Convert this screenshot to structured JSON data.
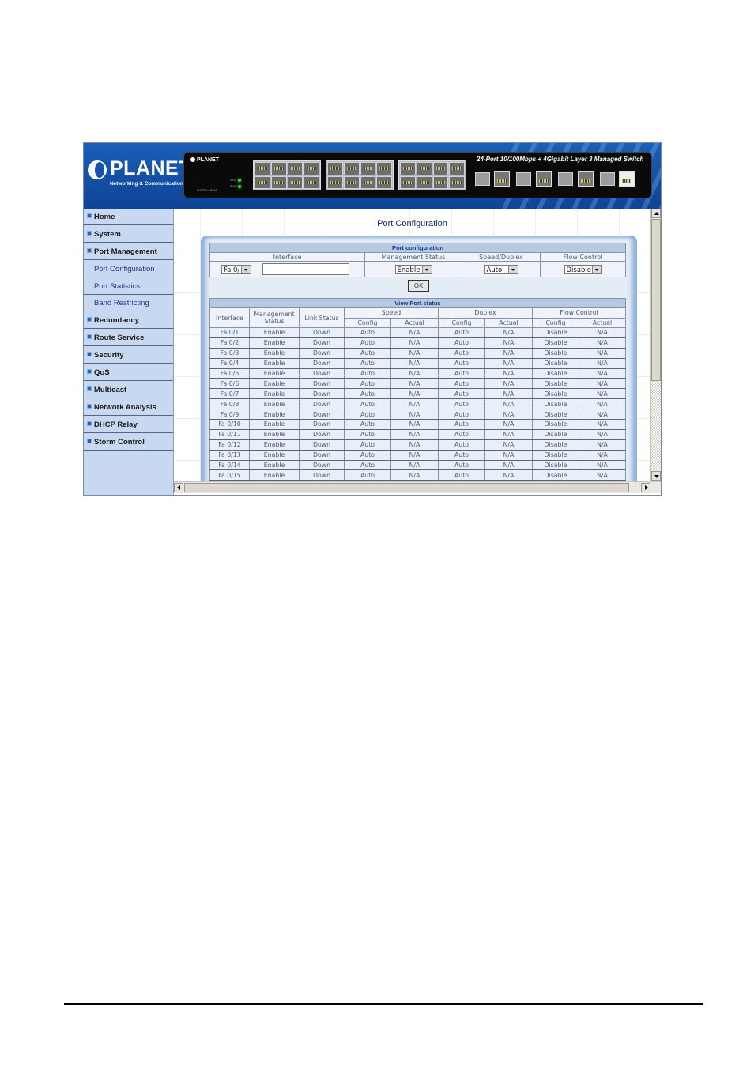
{
  "banner": {
    "brand": "PLANET",
    "tagline": "Networking & Communication",
    "device_logo": "PLANET",
    "device_model": "WGSW-L2648",
    "device_title": "24-Port 10/100Mbps + 4Gigabit Layer 3 Managed Switch",
    "led_labels": [
      "SYS",
      "PWR"
    ],
    "top_port_numbers": [
      "2",
      "4",
      "6",
      "8",
      "10",
      "12",
      "14",
      "16",
      "18",
      "20",
      "22",
      "24"
    ],
    "bottom_port_numbers": [
      "1",
      "3",
      "5",
      "7",
      "9",
      "11",
      "13",
      "15",
      "17",
      "19",
      "21",
      "23"
    ],
    "gigabit_labels": [
      "25",
      "26",
      "27",
      "28"
    ],
    "sfp_label": "mini-GBIC"
  },
  "sidebar": {
    "items": [
      {
        "label": "Home",
        "type": "main"
      },
      {
        "label": "System",
        "type": "main"
      },
      {
        "label": "Port Management",
        "type": "main"
      },
      {
        "label": "Port Configuration",
        "type": "sub"
      },
      {
        "label": "Port Statistics",
        "type": "sub"
      },
      {
        "label": "Band Restricting",
        "type": "sub"
      },
      {
        "label": "Redundancy",
        "type": "main"
      },
      {
        "label": "Route Service",
        "type": "main"
      },
      {
        "label": "Security",
        "type": "main"
      },
      {
        "label": "QoS",
        "type": "main"
      },
      {
        "label": "Multicast",
        "type": "main"
      },
      {
        "label": "Network Analysis",
        "type": "main"
      },
      {
        "label": "DHCP Relay",
        "type": "main"
      },
      {
        "label": "Storm Control",
        "type": "main"
      }
    ]
  },
  "page": {
    "title": "Port Configuration"
  },
  "config": {
    "section_title": "Port configuration",
    "headers": [
      "Interface",
      "Management Status",
      "Speed/Duplex",
      "Flow Control"
    ],
    "interface_select": "Fa 0/",
    "interface_input": "",
    "management_select": "Enable",
    "speed_select": "Auto",
    "flow_select": "Disable",
    "ok_label": "OK"
  },
  "status": {
    "section_title": "View Port status",
    "headers": {
      "interface": "Interface",
      "management": "Management Status",
      "link": "Link Status",
      "speed": "Speed",
      "duplex": "Duplex",
      "flow": "Flow Control",
      "config": "Config",
      "actual": "Actual"
    },
    "rows": [
      [
        "Fa 0/1",
        "Enable",
        "Down",
        "Auto",
        "N/A",
        "Auto",
        "N/A",
        "Disable",
        "N/A"
      ],
      [
        "Fa 0/2",
        "Enable",
        "Down",
        "Auto",
        "N/A",
        "Auto",
        "N/A",
        "Disable",
        "N/A"
      ],
      [
        "Fa 0/3",
        "Enable",
        "Down",
        "Auto",
        "N/A",
        "Auto",
        "N/A",
        "Disable",
        "N/A"
      ],
      [
        "Fa 0/4",
        "Enable",
        "Down",
        "Auto",
        "N/A",
        "Auto",
        "N/A",
        "Disable",
        "N/A"
      ],
      [
        "Fa 0/5",
        "Enable",
        "Down",
        "Auto",
        "N/A",
        "Auto",
        "N/A",
        "Disable",
        "N/A"
      ],
      [
        "Fa 0/6",
        "Enable",
        "Down",
        "Auto",
        "N/A",
        "Auto",
        "N/A",
        "Disable",
        "N/A"
      ],
      [
        "Fa 0/7",
        "Enable",
        "Down",
        "Auto",
        "N/A",
        "Auto",
        "N/A",
        "Disable",
        "N/A"
      ],
      [
        "Fa 0/8",
        "Enable",
        "Down",
        "Auto",
        "N/A",
        "Auto",
        "N/A",
        "Disable",
        "N/A"
      ],
      [
        "Fa 0/9",
        "Enable",
        "Down",
        "Auto",
        "N/A",
        "Auto",
        "N/A",
        "Disable",
        "N/A"
      ],
      [
        "Fa 0/10",
        "Enable",
        "Down",
        "Auto",
        "N/A",
        "Auto",
        "N/A",
        "Disable",
        "N/A"
      ],
      [
        "Fa 0/11",
        "Enable",
        "Down",
        "Auto",
        "N/A",
        "Auto",
        "N/A",
        "Disable",
        "N/A"
      ],
      [
        "Fa 0/12",
        "Enable",
        "Down",
        "Auto",
        "N/A",
        "Auto",
        "N/A",
        "Disable",
        "N/A"
      ],
      [
        "Fa 0/13",
        "Enable",
        "Down",
        "Auto",
        "N/A",
        "Auto",
        "N/A",
        "Disable",
        "N/A"
      ],
      [
        "Fa 0/14",
        "Enable",
        "Down",
        "Auto",
        "N/A",
        "Auto",
        "N/A",
        "Disable",
        "N/A"
      ],
      [
        "Fa 0/15",
        "Enable",
        "Down",
        "Auto",
        "N/A",
        "Auto",
        "N/A",
        "Disable",
        "N/A"
      ]
    ]
  },
  "icons": {
    "menu_bullet": "square-bullet-icon",
    "dropdown": "chevron-down-icon",
    "scroll_up": "arrow-up-icon",
    "scroll_down": "arrow-down-icon",
    "scroll_left": "arrow-left-icon",
    "scroll_right": "arrow-right-icon"
  }
}
